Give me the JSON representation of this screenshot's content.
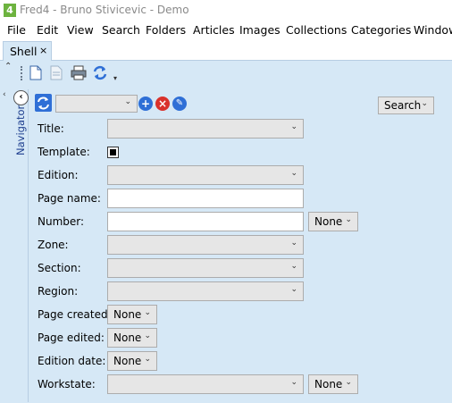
{
  "window": {
    "app_icon_text": "4",
    "title": "Fred4 - Bruno Stivicevic - Demo"
  },
  "menu": {
    "items": [
      "File",
      "Edit",
      "View",
      "Search",
      "Folders",
      "Articles",
      "Images",
      "Collections",
      "Categories",
      "Window"
    ]
  },
  "tabs": [
    {
      "label": "Shell",
      "close": "×"
    }
  ],
  "navigator": {
    "label": "Navigator",
    "collapse_icon": "‹"
  },
  "search_bar": {
    "query_value": "",
    "search_label": "Search"
  },
  "form": {
    "title_label": "Title:",
    "template_label": "Template:",
    "template_checked": true,
    "edition_label": "Edition:",
    "page_name_label": "Page name:",
    "page_name_value": "",
    "number_label": "Number:",
    "number_value": "",
    "number_op": "None",
    "zone_label": "Zone:",
    "section_label": "Section:",
    "region_label": "Region:",
    "page_created_label": "Page created:",
    "page_created_value": "None",
    "page_edited_label": "Page edited:",
    "page_edited_value": "None",
    "edition_date_label": "Edition date:",
    "edition_date_value": "None",
    "workstate_label": "Workstate:",
    "workstate_op": "None"
  },
  "colors": {
    "panel_bg": "#d6e8f6",
    "accent_blue": "#2f6fd6",
    "delete_red": "#d9312b",
    "app_green": "#6db33f"
  }
}
